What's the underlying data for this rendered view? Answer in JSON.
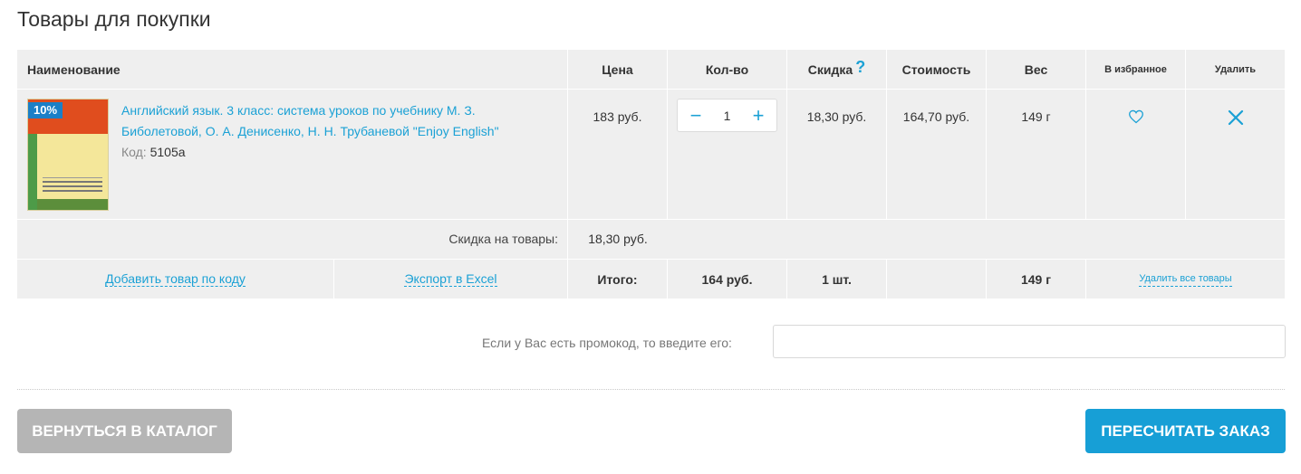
{
  "page_title": "Товары для покупки",
  "header": {
    "name": "Наименование",
    "price": "Цена",
    "qty": "Кол-во",
    "discount": "Скидка",
    "discount_help": "?",
    "cost": "Стоимость",
    "weight": "Вес",
    "favorite": "В избранное",
    "delete": "Удалить"
  },
  "item": {
    "image_badge": "10%",
    "title": "Английский язык. 3 класс: система уроков по учебнику М. З. Биболетовой, О. А. Денисенко, Н. Н. Трубаневой \"Enjoy English\"",
    "code_label": "Код:",
    "code_value": "5105а",
    "price": "183 руб.",
    "qty": "1",
    "qty_minus": "−",
    "qty_plus": "+",
    "discount": "18,30 руб.",
    "cost": "164,70 руб.",
    "weight": "149 г",
    "fav_icon": "heart-icon",
    "delete_icon": "close-icon"
  },
  "discount_row": {
    "label": "Скидка на товары:",
    "value": "18,30 руб."
  },
  "totals": {
    "add_by_code": "Добавить товар по коду",
    "export_excel": "Экспорт в Excel",
    "total_label": "Итого:",
    "total_sum": "164 руб.",
    "total_count": "1 шт.",
    "total_weight": "149 г",
    "delete_all": "Удалить все товары"
  },
  "promo": {
    "label": "Если у Вас есть промокод, то введите его:",
    "value": ""
  },
  "buttons": {
    "back": "Вернуться в каталог",
    "recalc": "Пересчитать заказ"
  },
  "colors": {
    "accent": "#1ba1d5",
    "row_bg": "#efefef",
    "back_button": "#b5b5b5",
    "primary_button": "#179fd6"
  }
}
